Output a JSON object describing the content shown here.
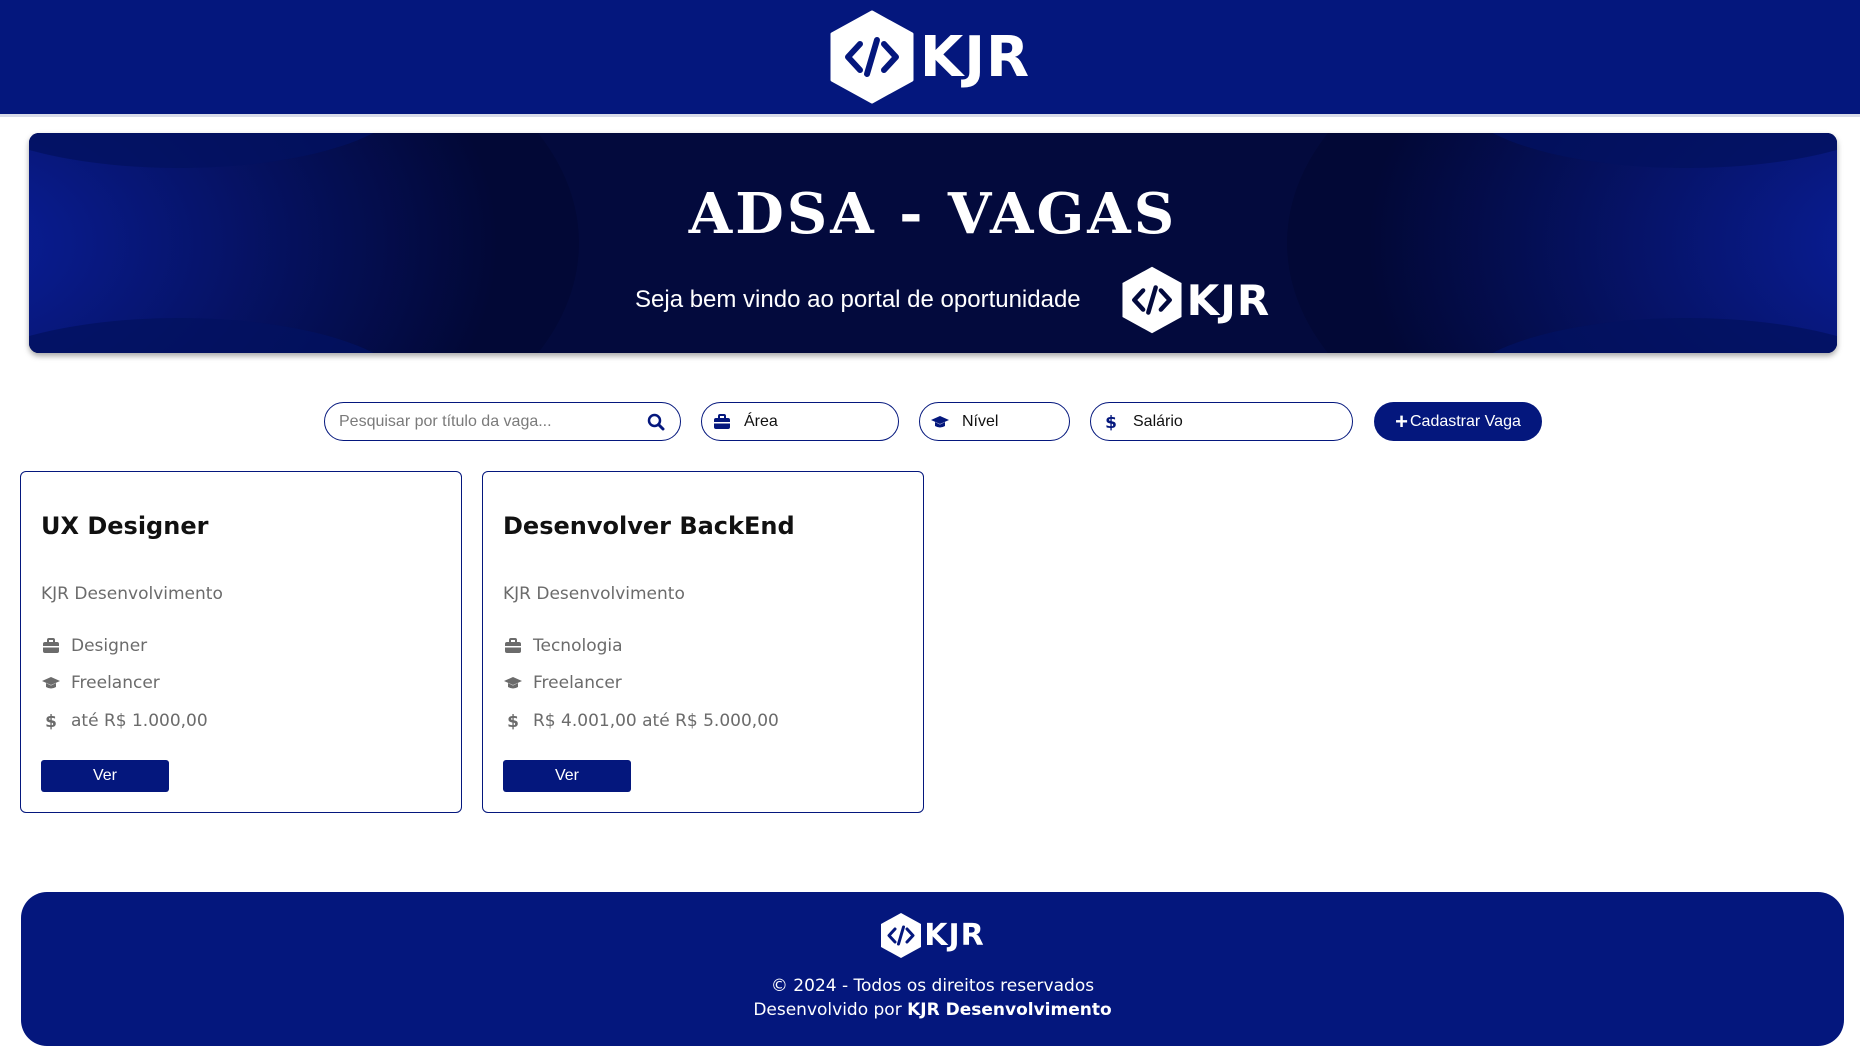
{
  "header": {
    "logo_text": "KJR",
    "logo_icon": "code-hexagon-icon"
  },
  "banner": {
    "title": "ADSA - VAGAS",
    "subtitle": "Seja bem vindo ao portal de oportunidade",
    "logo_text": "KJR"
  },
  "filters": {
    "search": {
      "placeholder": "Pesquisar por título da vaga...",
      "icon": "search-icon"
    },
    "area": {
      "label": "Área",
      "icon": "briefcase-icon"
    },
    "nivel": {
      "label": "Nível",
      "icon": "graduation-cap-icon"
    },
    "salario": {
      "label": "Salário",
      "icon": "dollar-icon"
    },
    "add_button": {
      "plus": "+",
      "label": "Cadastrar Vaga"
    }
  },
  "jobs": [
    {
      "title": "UX Designer",
      "company": "KJR Desenvolvimento",
      "area": "Designer",
      "level": "Freelancer",
      "salary": "até R$ 1.000,00",
      "button": "Ver"
    },
    {
      "title": "Desenvolver BackEnd",
      "company": "KJR Desenvolvimento",
      "area": "Tecnologia",
      "level": "Freelancer",
      "salary": "R$ 4.001,00 até R$ 5.000,00",
      "button": "Ver"
    }
  ],
  "footer": {
    "logo_text": "KJR",
    "copyright": "© 2024 - Todos os direitos reservados",
    "dev_prefix": "Desenvolvido por ",
    "dev_name": "KJR Desenvolvimento"
  },
  "colors": {
    "primary": "#04177d",
    "banner_bg": "#030a3d",
    "muted_text": "#6b6b6b"
  }
}
